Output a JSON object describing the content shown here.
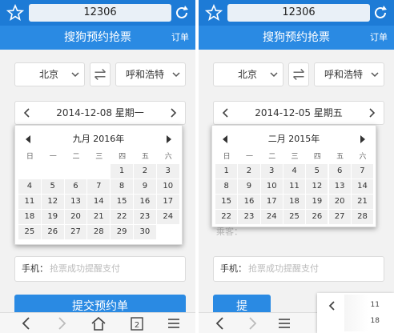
{
  "left": {
    "url": "12306",
    "title": "搜狗预约抢票",
    "order": "订单",
    "from": "北京",
    "to": "呼和浩特",
    "date": "2014-12-08 星期一",
    "calendar": {
      "month_label": "九月 2016年",
      "weekdays": [
        "日",
        "一",
        "二",
        "三",
        "四",
        "五",
        "六"
      ],
      "rows": [
        [
          "",
          "",
          "",
          "",
          "1",
          "2",
          "3"
        ],
        [
          "4",
          "5",
          "6",
          "7",
          "8",
          "9",
          "10"
        ],
        [
          "11",
          "12",
          "13",
          "14",
          "15",
          "16",
          "17"
        ],
        [
          "18",
          "19",
          "20",
          "21",
          "22",
          "23",
          "24"
        ],
        [
          "25",
          "26",
          "27",
          "28",
          "29",
          "30",
          ""
        ]
      ]
    },
    "phone_label": "手机：",
    "phone_placeholder": "抢票成功提醒支付",
    "submit": "提交预约单",
    "tab_count": "2"
  },
  "right": {
    "url": "12306",
    "title": "搜狗预约抢票",
    "order": "订单",
    "from": "北京",
    "to": "呼和浩特",
    "date": "2014-12-05 星期五",
    "calendar": {
      "month_label": "二月 2015年",
      "weekdays": [
        "日",
        "一",
        "二",
        "三",
        "四",
        "五",
        "六"
      ],
      "rows": [
        [
          "1",
          "2",
          "3",
          "4",
          "5",
          "6",
          "7"
        ],
        [
          "8",
          "9",
          "10",
          "11",
          "12",
          "13",
          "14"
        ],
        [
          "15",
          "16",
          "17",
          "18",
          "19",
          "20",
          "21"
        ],
        [
          "22",
          "23",
          "24",
          "25",
          "26",
          "27",
          "28"
        ]
      ]
    },
    "passenger_hint": "乘客：",
    "phone_label": "手机：",
    "phone_placeholder": "抢票成功提醒支付",
    "submit": "提",
    "mini": {
      "a": "11",
      "b": "18"
    }
  },
  "colors": {
    "brand": "#2a8ae3",
    "urlbar": "#1d7bd6"
  }
}
